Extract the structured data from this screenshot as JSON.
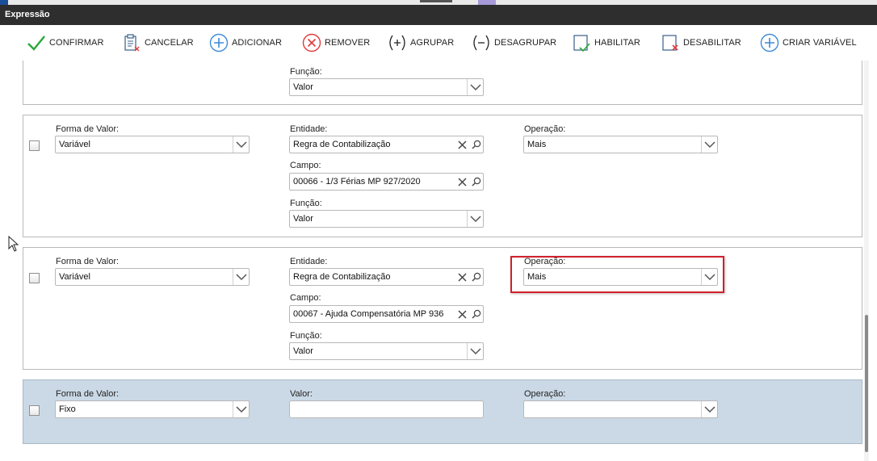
{
  "window": {
    "title": "Expressão"
  },
  "toolbar": {
    "buttons": [
      {
        "label": "CONFIRMAR",
        "icon": "check-icon"
      },
      {
        "label": "CANCELAR",
        "icon": "cancel-document-icon"
      },
      {
        "label": "ADICIONAR",
        "icon": "plus-circle-icon"
      },
      {
        "label": "REMOVER",
        "icon": "x-circle-icon"
      },
      {
        "label": "AGRUPAR",
        "icon": "group-plus-icon"
      },
      {
        "label": "DESAGRUPAR",
        "icon": "ungroup-minus-icon"
      },
      {
        "label": "HABILITAR",
        "icon": "enable-checkbox-icon"
      },
      {
        "label": "DESABILITAR",
        "icon": "disable-checkbox-icon"
      },
      {
        "label": "CRIAR VARIÁVEL",
        "icon": "plus-circle-icon"
      }
    ]
  },
  "rows": [
    {
      "funcao_label": "Função:",
      "funcao_value": "Valor"
    },
    {
      "forma_label": "Forma de Valor:",
      "forma_value": "Variável",
      "entidade_label": "Entidade:",
      "entidade_value": "Regra de Contabilização",
      "campo_label": "Campo:",
      "campo_value": "00066 - 1/3 Férias MP 927/2020",
      "funcao_label": "Função:",
      "funcao_value": "Valor",
      "operacao_label": "Operação:",
      "operacao_value": "Mais"
    },
    {
      "forma_label": "Forma de Valor:",
      "forma_value": "Variável",
      "entidade_label": "Entidade:",
      "entidade_value": "Regra de Contabilização",
      "campo_label": "Campo:",
      "campo_value": "00067 - Ajuda Compensatória MP 936",
      "funcao_label": "Função:",
      "funcao_value": "Valor",
      "operacao_label": "Operação:",
      "operacao_value": "Mais"
    },
    {
      "forma_label": "Forma de Valor:",
      "forma_value": "Fixo",
      "valor_label": "Valor:",
      "valor_value": "",
      "operacao_label": "Operação:",
      "operacao_value": ""
    }
  ],
  "colors": {
    "titlebar": "#2e2e2e",
    "selected_row": "#cbd9e6",
    "highlight": "#d21f2b",
    "confirm_green": "#2aa63a",
    "remove_red": "#e03a3a",
    "add_blue": "#3d8ad8"
  }
}
